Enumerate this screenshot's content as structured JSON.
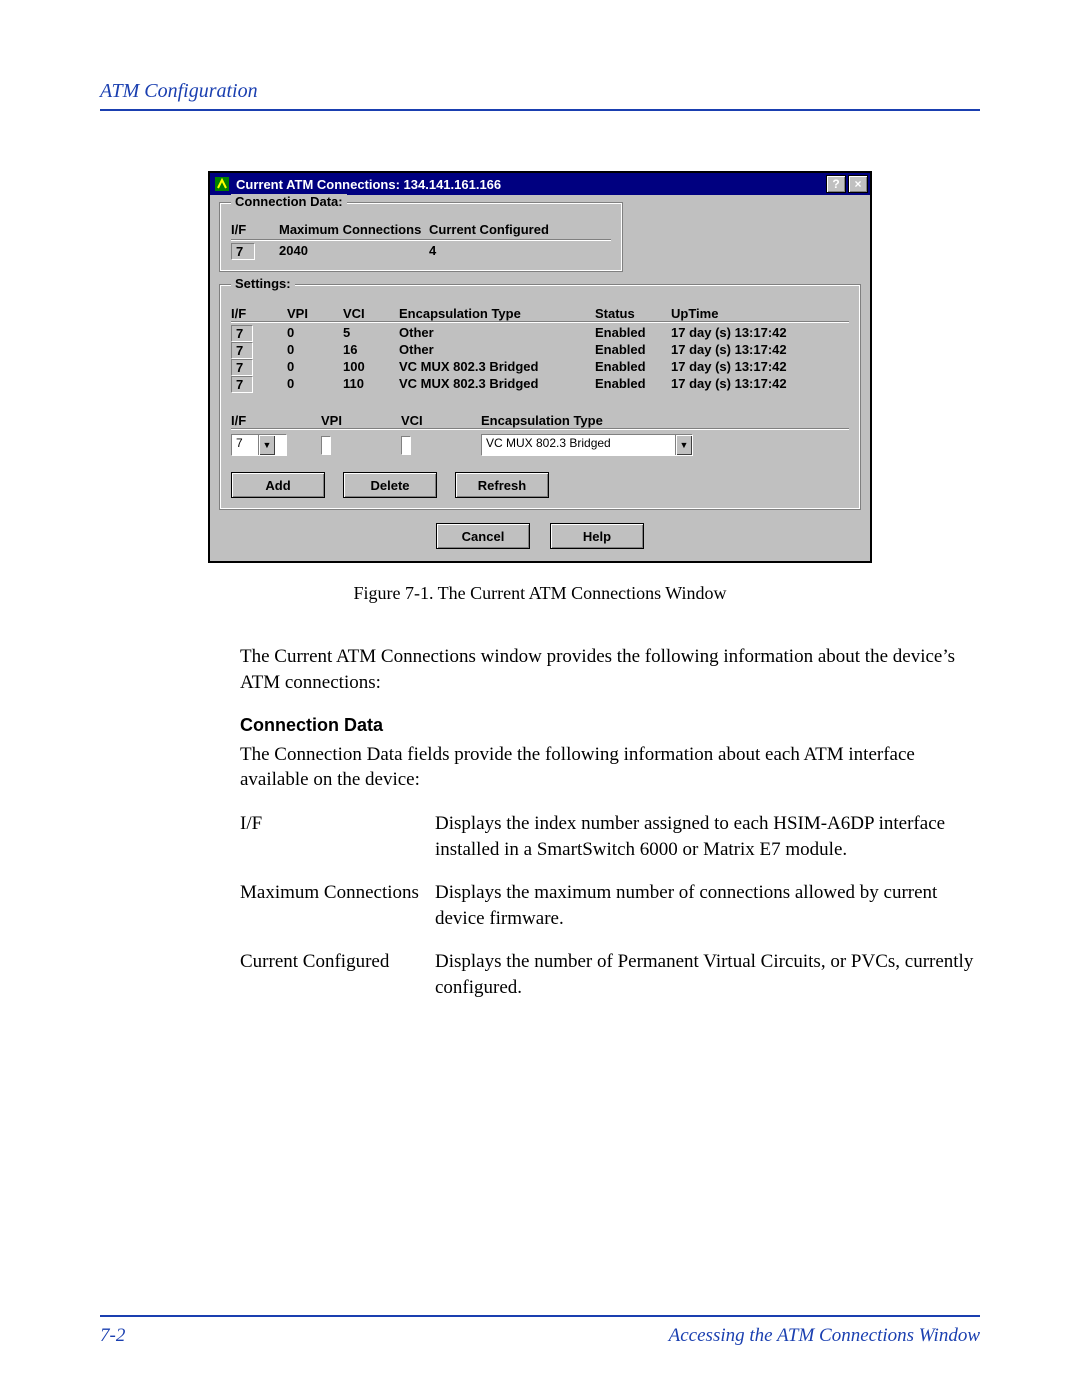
{
  "header": "ATM Configuration",
  "dialog": {
    "title": "Current ATM Connections: 134.141.161.166",
    "help_btn": "?",
    "close_btn": "×",
    "groups": {
      "connection_data": {
        "legend": "Connection Data:",
        "headers": {
          "if": "I/F",
          "max": "Maximum Connections",
          "cur": "Current Configured"
        },
        "row": {
          "if": "7",
          "max": "2040",
          "cur": "4"
        }
      },
      "settings": {
        "legend": "Settings:",
        "headers": {
          "if": "I/F",
          "vpi": "VPI",
          "vci": "VCI",
          "encap": "Encapsulation Type",
          "status": "Status",
          "uptime": "UpTime"
        },
        "rows": [
          {
            "if": "7",
            "vpi": "0",
            "vci": "5",
            "encap": "Other",
            "status": "Enabled",
            "uptime": "17 day (s) 13:17:42"
          },
          {
            "if": "7",
            "vpi": "0",
            "vci": "16",
            "encap": "Other",
            "status": "Enabled",
            "uptime": "17 day (s) 13:17:42"
          },
          {
            "if": "7",
            "vpi": "0",
            "vci": "100",
            "encap": "VC MUX 802.3 Bridged",
            "status": "Enabled",
            "uptime": "17 day (s) 13:17:42"
          },
          {
            "if": "7",
            "vpi": "0",
            "vci": "110",
            "encap": "VC MUX 802.3 Bridged",
            "status": "Enabled",
            "uptime": "17 day (s) 13:17:42"
          }
        ],
        "edit_headers": {
          "if": "I/F",
          "vpi": "VPI",
          "vci": "VCI",
          "encap": "Encapsulation Type"
        },
        "edit_row": {
          "if": "7",
          "vpi": "",
          "vci": "",
          "encap": "VC MUX 802.3 Bridged"
        },
        "buttons": {
          "add": "Add",
          "delete": "Delete",
          "refresh": "Refresh"
        }
      }
    },
    "bottom_buttons": {
      "cancel": "Cancel",
      "help": "Help"
    }
  },
  "caption": "Figure 7-1.  The Current ATM Connections Window",
  "intro_para": "The Current ATM Connections window provides the following information about the device’s ATM connections:",
  "section_heading": "Connection Data",
  "section_para": "The Connection Data fields provide the following information about each ATM interface available on the device:",
  "definitions": [
    {
      "term": "I/F",
      "desc": "Displays the index number assigned to each HSIM-A6DP interface installed in a SmartSwitch 6000 or Matrix E7 module."
    },
    {
      "term": "Maximum Connections",
      "desc": "Displays the maximum number of connections allowed by current device firmware."
    },
    {
      "term": "Current Configured",
      "desc": "Displays the number of Permanent Virtual Circuits, or PVCs, currently configured."
    }
  ],
  "footer": {
    "left": "7-2",
    "right": "Accessing the ATM Connections Window"
  }
}
